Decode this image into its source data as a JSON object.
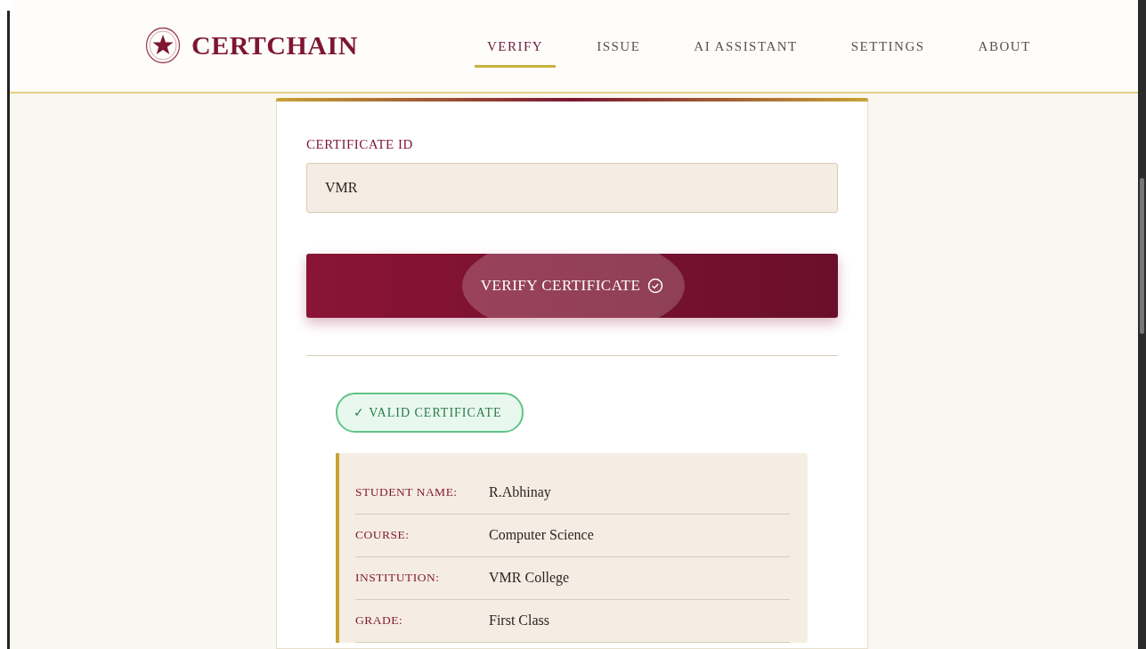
{
  "brand": {
    "name": "CERTCHAIN"
  },
  "nav": [
    {
      "label": "VERIFY",
      "selected": true
    },
    {
      "label": "ISSUE",
      "selected": false
    },
    {
      "label": "AI ASSISTANT",
      "selected": false
    },
    {
      "label": "SETTINGS",
      "selected": false
    },
    {
      "label": "ABOUT",
      "selected": false
    }
  ],
  "form": {
    "label": "CERTIFICATE ID",
    "value": "VMR",
    "button": "VERIFY CERTIFICATE"
  },
  "result": {
    "status": "✓ VALID CERTIFICATE",
    "valid": true,
    "fields": [
      {
        "label": "STUDENT NAME:",
        "value": "R.Abhinay"
      },
      {
        "label": "COURSE:",
        "value": "Computer Science"
      },
      {
        "label": "INSTITUTION:",
        "value": "VMR College"
      },
      {
        "label": "GRADE:",
        "value": "First Class"
      }
    ]
  }
}
